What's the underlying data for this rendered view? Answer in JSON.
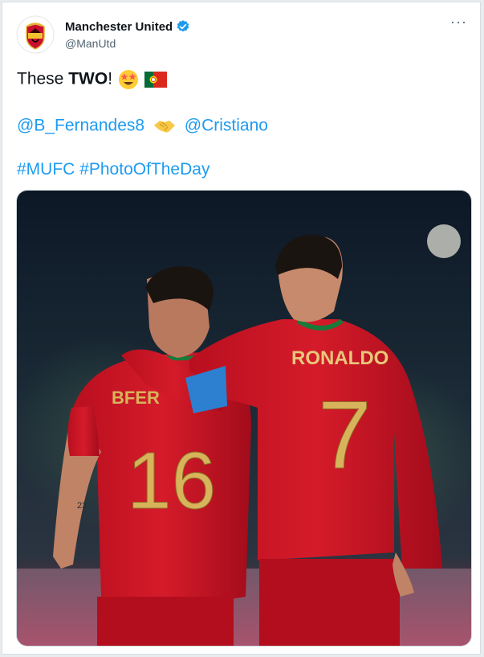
{
  "author": {
    "name": "Manchester United",
    "handle": "@ManUtd"
  },
  "tweet": {
    "line1_prefix": "These ",
    "line1_bold": "TWO",
    "line1_suffix": "!",
    "mention1": "@B_Fernandes8",
    "mention2": "@Cristiano",
    "hashtag1": "#MUFC",
    "hashtag2": "#PhotoOfTheDay",
    "emojis": [
      "star-struck-emoji",
      "portugal-flag-emoji",
      "handshake-emoji"
    ]
  },
  "photo": {
    "left_player_name": "BFER",
    "left_player_number": "16",
    "right_player_name": "RONALDO",
    "right_player_number": "7",
    "tattoo": "23"
  },
  "colors": {
    "link": "#1d9bf0",
    "verified": "#1d9bf0",
    "jersey_red": "#d01426",
    "jersey_gold": "#d7b45b",
    "armband_blue": "#2d7fd0"
  }
}
